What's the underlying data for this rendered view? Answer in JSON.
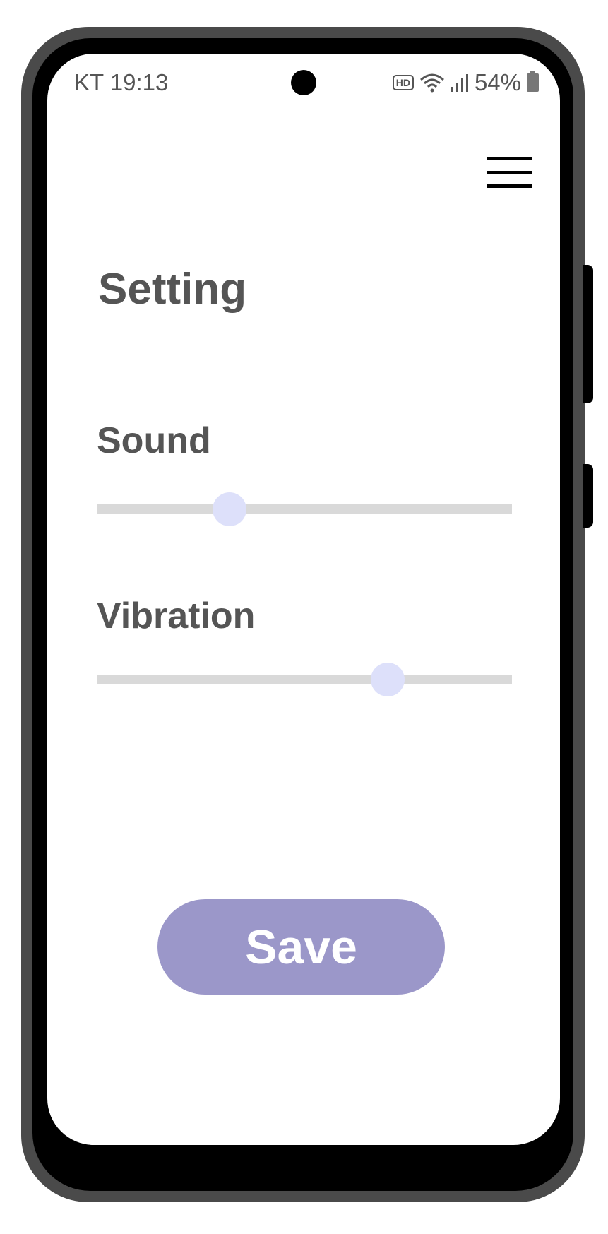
{
  "status_bar": {
    "carrier_time": "KT 19:13",
    "hd_badge": "HD",
    "battery": "54%"
  },
  "header": {
    "menu_icon": "hamburger-menu-icon",
    "title": "Setting"
  },
  "settings": {
    "sound": {
      "label": "Sound",
      "level": 0.32
    },
    "vibration": {
      "label": "Vibration",
      "level": 0.7
    }
  },
  "actions": {
    "save_label": "Save"
  },
  "colors": {
    "save_button": "#9b97c9",
    "slider_thumb": "#dde0fa",
    "slider_track": "#d9d9d9",
    "text": "#555555"
  }
}
